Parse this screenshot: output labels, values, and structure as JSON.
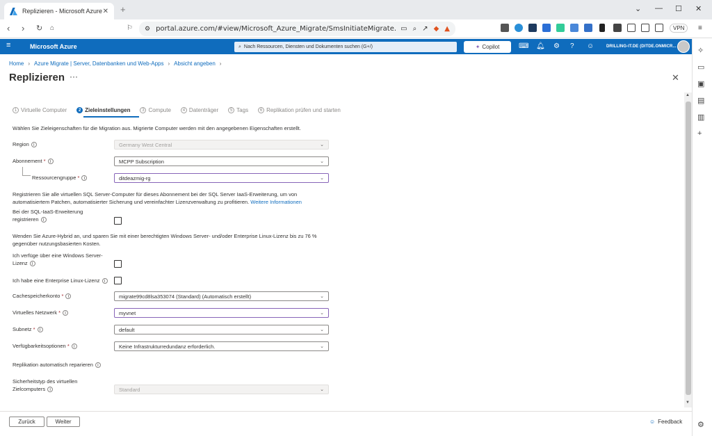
{
  "browser": {
    "tab_title": "Replizieren - Microsoft Azure",
    "url": "portal.azure.com/#view/Microsoft_Azure_Migrate/SmsInitiateMigrate...",
    "vpn": "VPN"
  },
  "azure": {
    "brand": "Microsoft Azure",
    "search_placeholder": "Nach Ressourcen, Diensten und Dokumenten suchen (G+/)",
    "copilot": "Copilot",
    "account": "DRILLING-IT.DE (DITDE.ONMICR..."
  },
  "breadcrumb": [
    "Home",
    "Azure Migrate | Server, Datenbanken und Web-Apps",
    "Absicht angeben"
  ],
  "page": {
    "title": "Replizieren",
    "more": "···"
  },
  "steps": [
    {
      "num": "1",
      "label": "Virtuelle Computer"
    },
    {
      "num": "2",
      "label": "Zieleinstellungen"
    },
    {
      "num": "3",
      "label": "Compute"
    },
    {
      "num": "4",
      "label": "Datenträger"
    },
    {
      "num": "5",
      "label": "Tags"
    },
    {
      "num": "6",
      "label": "Replikation prüfen und starten"
    }
  ],
  "intro": "Wählen Sie Zieleigenschaften für die Migration aus. Migrierte Computer werden mit den angegebenen Eigenschaften erstellt.",
  "form": {
    "region_label": "Region",
    "region_value": "Germany West Central",
    "abo_label": "Abonnement",
    "abo_value": "MCPP Subscription",
    "rg_label": "Ressourcengruppe",
    "rg_value": "ditdeazmig-rg",
    "sql_text": "Registrieren Sie alle virtuellen SQL Server-Computer für dieses Abonnement bei der SQL Server IaaS-Erweiterung, um von automatisiertem Patchen, automatisierter Sicherung und vereinfachter Lizenzverwaltung zu profitieren.",
    "sql_link": "Weitere Informationen",
    "sql_reg_label1": "Bei der SQL-IaaS-Erweiterung",
    "sql_reg_label2": "registrieren",
    "hybrid_text": "Wenden Sie Azure-Hybrid an, und sparen Sie mit einer berechtigten Windows Server- und/oder Enterprise Linux-Lizenz bis zu 76 % gegenüber nutzungsbasierten Kosten.",
    "win_label1": "Ich verfüge über eine Windows Server-",
    "win_label2": "Lizenz",
    "linux_label": "Ich habe eine Enterprise Linux-Lizenz",
    "cache_label": "Cachespeicherkonto",
    "cache_value": "migrate99cd8lsa353074 (Standard) (Automatisch erstellt)",
    "vnet_label": "Virtuelles Netzwerk",
    "vnet_value": "myvnet",
    "subnet_label": "Subnetz",
    "subnet_value": "default",
    "avail_label": "Verfügbarkeitsoptionen",
    "avail_value": "Keine Infrastrukturredundanz erforderlich.",
    "repair_label": "Replikation automatisch reparieren",
    "sec_label1": "Sicherheitstyp des virtuellen",
    "sec_label2": "Zielcomputers",
    "sec_value": "Standard"
  },
  "footer": {
    "back": "Zurück",
    "next": "Weiter",
    "feedback": "Feedback"
  }
}
